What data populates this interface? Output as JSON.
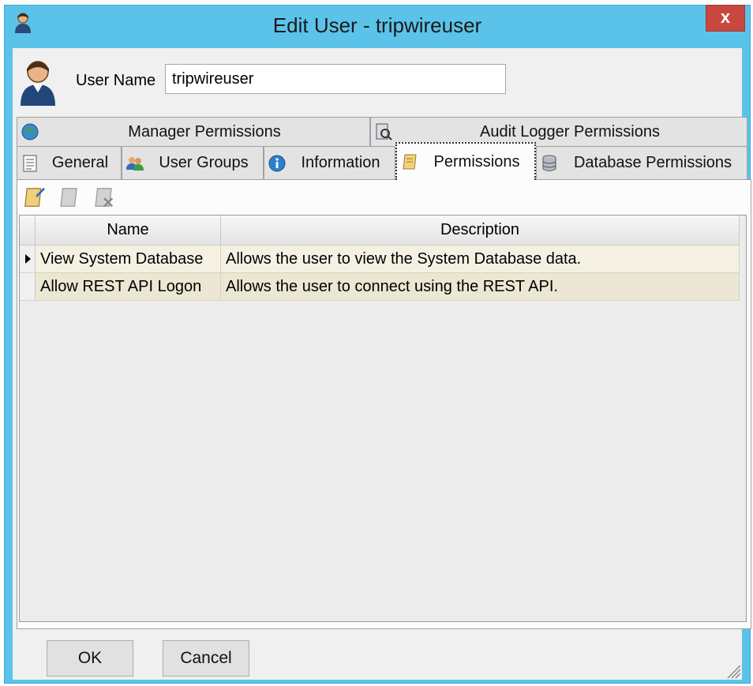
{
  "window": {
    "title": "Edit User - tripwireuser",
    "close_label": "x"
  },
  "user": {
    "name_label": "User Name",
    "name_value": "tripwireuser"
  },
  "tabs_row1": [
    {
      "label": "Manager Permissions",
      "icon": "globe-key-icon"
    },
    {
      "label": "Audit Logger Permissions",
      "icon": "audit-log-icon"
    }
  ],
  "tabs_row2": [
    {
      "label": "General",
      "icon": "document-icon"
    },
    {
      "label": "User Groups",
      "icon": "user-group-icon"
    },
    {
      "label": "Information",
      "icon": "info-icon"
    },
    {
      "label": "Permissions",
      "icon": "scroll-icon",
      "active": true
    },
    {
      "label": "Database Permissions",
      "icon": "database-icon"
    }
  ],
  "toolbar": {
    "edit_icon": "edit-scroll-icon",
    "view_icon": "scroll-icon",
    "remove_icon": "remove-scroll-icon"
  },
  "grid": {
    "columns": [
      "Name",
      "Description"
    ],
    "rows": [
      {
        "name": "View System Database",
        "description": "Allows the user to view the System Database data.",
        "current": true
      },
      {
        "name": "Allow REST API Logon",
        "description": "Allows the user to connect using the REST API.",
        "current": false
      }
    ]
  },
  "buttons": {
    "ok": "OK",
    "cancel": "Cancel"
  },
  "colors": {
    "titlebar": "#5bc3ea",
    "close": "#c9473e",
    "row_bg": "#f5f1e2",
    "row_alt": "#ebe7d3"
  }
}
